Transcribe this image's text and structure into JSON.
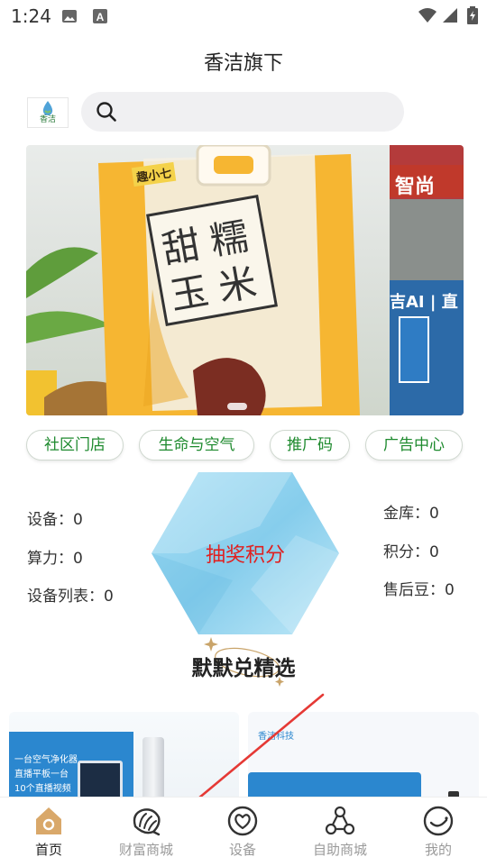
{
  "status_bar": {
    "time": "1:24"
  },
  "header": {
    "title": "香洁旗下"
  },
  "logo": {
    "text": "香洁"
  },
  "search": {
    "placeholder": ""
  },
  "banner": {
    "product_name_chars": [
      "甜",
      "糯",
      "玉",
      "米"
    ],
    "brand_text": "趣小七",
    "slide2_text_top": "智尚",
    "slide2_text_mid": "吉AI | 直"
  },
  "quick_links": [
    "社区门店",
    "生命与空气",
    "推广码",
    "广告中心"
  ],
  "stats_left": [
    {
      "label": "设备：",
      "value": "0"
    },
    {
      "label": "算力：",
      "value": "0"
    },
    {
      "label": "设备列表：",
      "value": "0"
    }
  ],
  "stats_right": [
    {
      "label": "金库：",
      "value": "0"
    },
    {
      "label": "积分：",
      "value": "0"
    },
    {
      "label": "售后豆：",
      "value": "0"
    }
  ],
  "lottery": {
    "label": "抽奖积分"
  },
  "section": {
    "title": "默默兑精选"
  },
  "cards": {
    "card1_lines": [
      "一台空气净化器",
      "直播平板一台",
      "10个直播视频"
    ],
    "card2_brand": "香洁科技"
  },
  "tabs": [
    {
      "label": "首页",
      "icon": "home-icon",
      "active": true
    },
    {
      "label": "财富商城",
      "icon": "shell-icon",
      "active": false
    },
    {
      "label": "设备",
      "icon": "heart-device-icon",
      "active": false
    },
    {
      "label": "自助商城",
      "icon": "nodes-icon",
      "active": false
    },
    {
      "label": "我的",
      "icon": "smile-icon",
      "active": false
    }
  ],
  "colors": {
    "accent_green": "#1e8a2e",
    "lottery_red": "#e02020",
    "hex_blue": "#8fd2ee",
    "annotation_red": "#e53935"
  }
}
